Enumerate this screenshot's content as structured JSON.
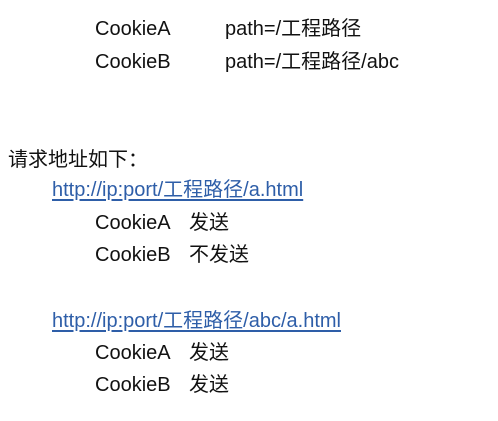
{
  "cookies": [
    {
      "name": "CookieA",
      "path": "path=/工程路径"
    },
    {
      "name": "CookieB",
      "path": "path=/工程路径/abc"
    }
  ],
  "requests_heading": "请求地址如下：",
  "requests": [
    {
      "url": "http://ip:port/工程路径/a.html",
      "results": [
        {
          "cookie": "CookieA",
          "status": "发送"
        },
        {
          "cookie": "CookieB",
          "status": "不发送"
        }
      ]
    },
    {
      "url": "http://ip:port/工程路径/abc/a.html",
      "results": [
        {
          "cookie": "CookieA",
          "status": "发送"
        },
        {
          "cookie": "CookieB",
          "status": "发送"
        }
      ]
    }
  ]
}
